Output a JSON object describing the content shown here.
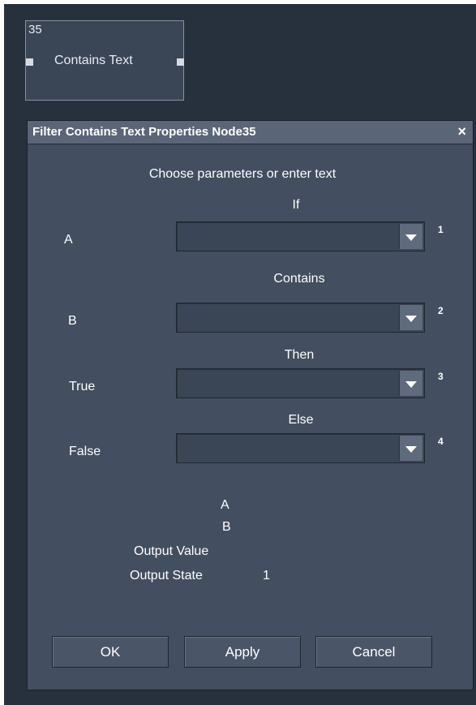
{
  "node": {
    "id": "35",
    "label": "Contains Text"
  },
  "dialog": {
    "title": "Filter Contains Text Properties Node35",
    "close_glyph": "×",
    "heading": "Choose parameters or enter text",
    "sections": {
      "if": "If",
      "contains": "Contains",
      "then": "Then",
      "else": "Else"
    },
    "fields": [
      {
        "label": "A",
        "value": "",
        "index": "1"
      },
      {
        "label": "B",
        "value": "",
        "index": "2"
      },
      {
        "label": "True",
        "value": "",
        "index": "3"
      },
      {
        "label": "False",
        "value": "",
        "index": "4"
      }
    ],
    "status": {
      "a_label": "A",
      "b_label": "B",
      "output_value_label": "Output Value",
      "output_state_label": "Output State",
      "output_state_value": "1"
    },
    "buttons": {
      "ok": "OK",
      "apply": "Apply",
      "cancel": "Cancel"
    }
  },
  "colors": {
    "canvas": "#27303d",
    "dialog": "#434e60",
    "titlebar": "#5a6577",
    "text": "#ffffff"
  }
}
